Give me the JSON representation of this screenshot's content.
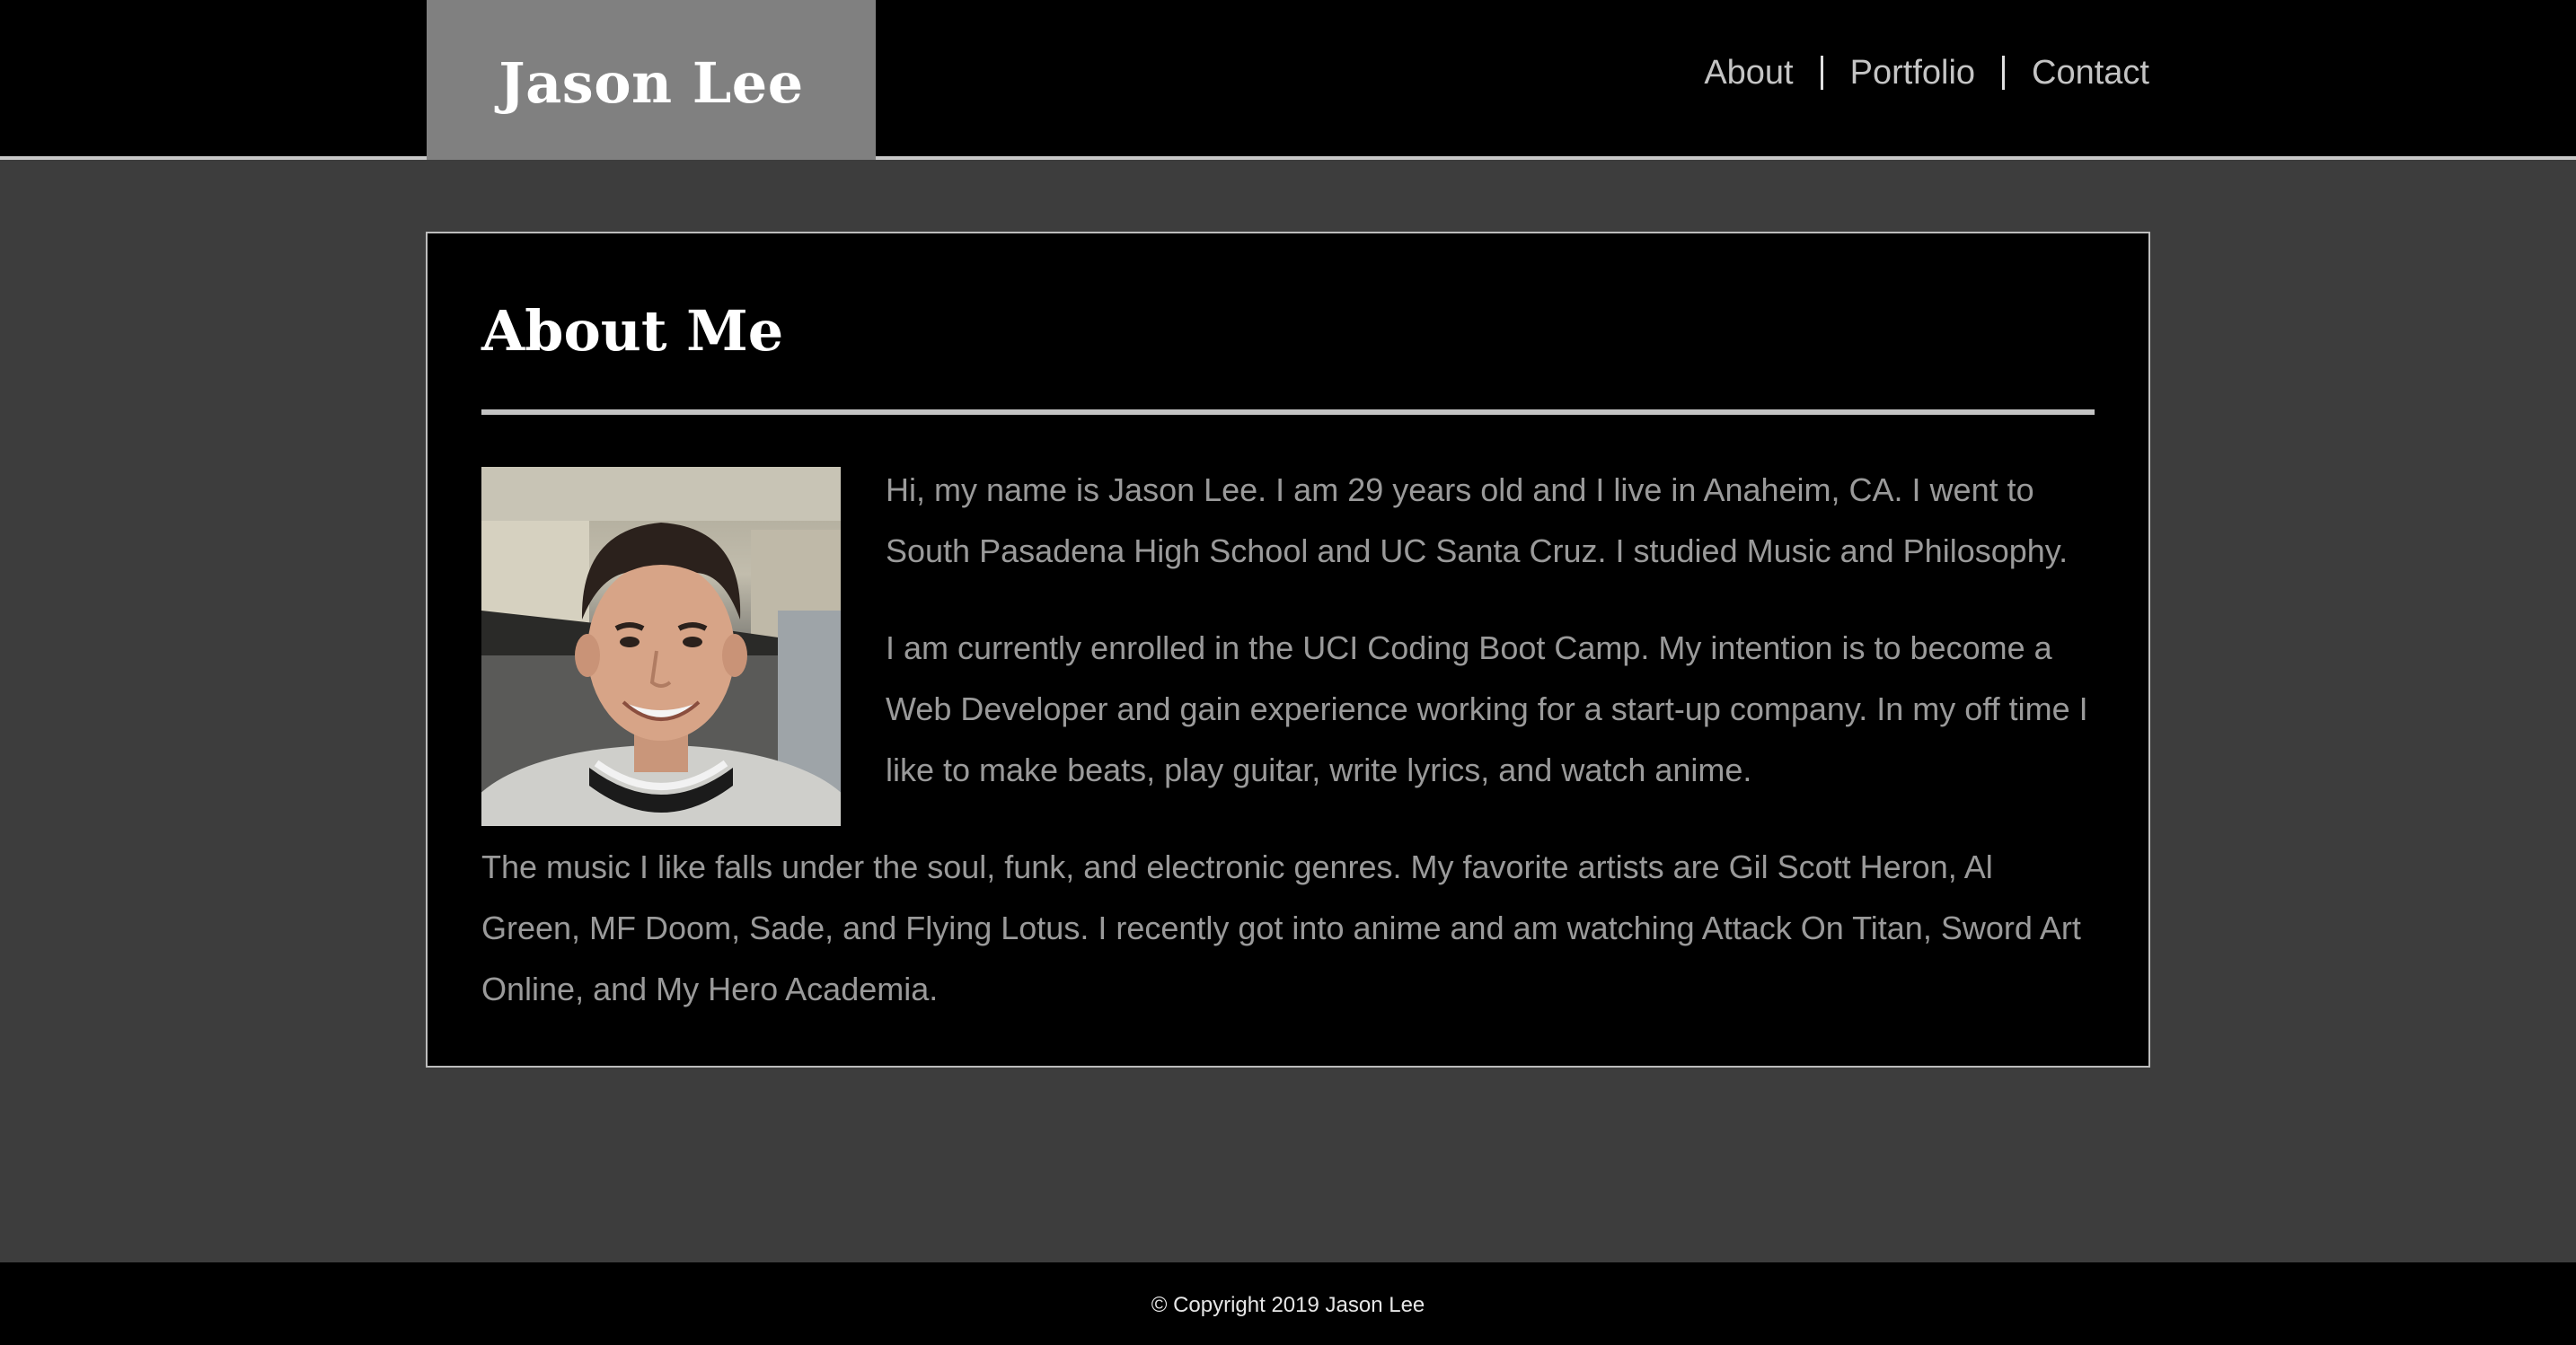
{
  "header": {
    "brand_name": "Jason Lee",
    "nav": [
      {
        "label": "About"
      },
      {
        "label": "Portfolio"
      },
      {
        "label": "Contact"
      }
    ]
  },
  "about": {
    "title": "About Me",
    "paragraphs": [
      "Hi, my name is Jason Lee. I am 29 years old and I live in Anaheim, CA. I went to South Pasadena High School and UC Santa Cruz. I studied Music and Philosophy.",
      "I am currently enrolled in the UCI Coding Boot Camp. My intention is to become a Web Developer and gain experience working for a start-up company. In my off time I like to make beats, play guitar, write lyrics, and watch anime.",
      "The music I like falls under the soul, funk, and electronic genres. My favorite artists are Gil Scott Heron, Al Green, MF Doom, Sade, and Flying Lotus. I recently got into anime and am watching Attack On Titan, Sword Art Online, and My Hero Academia."
    ]
  },
  "footer": {
    "copyright": "© Copyright 2019 Jason Lee"
  },
  "colors": {
    "page_background": "#3d3d3d",
    "header_background": "#000000",
    "brand_background": "#808080",
    "card_background": "#000000",
    "body_text": "#9a9a9a",
    "nav_text": "#c4c4c4"
  }
}
